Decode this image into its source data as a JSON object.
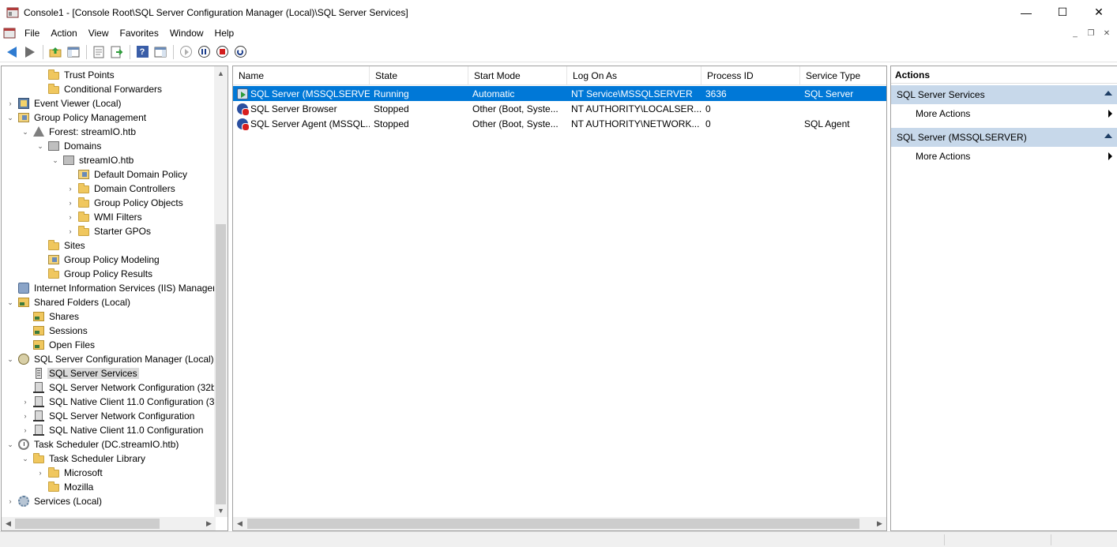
{
  "window": {
    "title": "Console1 - [Console Root\\SQL Server Configuration Manager (Local)\\SQL Server Services]",
    "controls": {
      "minimize": "—",
      "maximize": "☐",
      "close": "✕"
    }
  },
  "menu": {
    "items": [
      "File",
      "Action",
      "View",
      "Favorites",
      "Window",
      "Help"
    ],
    "mdi": {
      "minimize": "_",
      "restore": "❐",
      "close": "✕"
    }
  },
  "toolbar": {
    "buttons": [
      "back-icon",
      "forward-icon",
      "up-one-level-icon",
      "show-hide-console-tree-icon",
      "properties-icon",
      "export-list-icon",
      "help-icon",
      "show-hide-action-pane-icon",
      "start-service-icon",
      "pause-service-icon",
      "stop-service-icon",
      "restart-service-icon"
    ]
  },
  "tree": {
    "items": [
      {
        "label": "Trust Points",
        "indent": 3,
        "expander": "",
        "icon": "folder"
      },
      {
        "label": "Conditional Forwarders",
        "indent": 3,
        "expander": "",
        "icon": "folder"
      },
      {
        "label": "Event Viewer (Local)",
        "indent": 1,
        "expander": "›",
        "icon": "viewer"
      },
      {
        "label": "Group Policy Management",
        "indent": 1,
        "expander": "⌄",
        "icon": "gpo"
      },
      {
        "label": "Forest: streamIO.htb",
        "indent": 2,
        "expander": "⌄",
        "icon": "forest"
      },
      {
        "label": "Domains",
        "indent": 3,
        "expander": "⌄",
        "icon": "domain"
      },
      {
        "label": "streamIO.htb",
        "indent": 4,
        "expander": "⌄",
        "icon": "domain"
      },
      {
        "label": "Default Domain Policy",
        "indent": 5,
        "expander": "",
        "icon": "gpo"
      },
      {
        "label": "Domain Controllers",
        "indent": 5,
        "expander": "›",
        "icon": "folder"
      },
      {
        "label": "Group Policy Objects",
        "indent": 5,
        "expander": "›",
        "icon": "folder"
      },
      {
        "label": "WMI Filters",
        "indent": 5,
        "expander": "›",
        "icon": "folder"
      },
      {
        "label": "Starter GPOs",
        "indent": 5,
        "expander": "›",
        "icon": "folder"
      },
      {
        "label": "Sites",
        "indent": 3,
        "expander": "",
        "icon": "folder"
      },
      {
        "label": "Group Policy Modeling",
        "indent": 3,
        "expander": "",
        "icon": "gpo"
      },
      {
        "label": "Group Policy Results",
        "indent": 3,
        "expander": "",
        "icon": "folder"
      },
      {
        "label": "Internet Information Services (IIS) Manager",
        "indent": 1,
        "expander": "",
        "icon": "iis"
      },
      {
        "label": "Shared Folders (Local)",
        "indent": 1,
        "expander": "⌄",
        "icon": "share"
      },
      {
        "label": "Shares",
        "indent": 2,
        "expander": "",
        "icon": "share"
      },
      {
        "label": "Sessions",
        "indent": 2,
        "expander": "",
        "icon": "share"
      },
      {
        "label": "Open Files",
        "indent": 2,
        "expander": "",
        "icon": "share"
      },
      {
        "label": "SQL Server Configuration Manager (Local)",
        "indent": 1,
        "expander": "⌄",
        "icon": "sqlcm"
      },
      {
        "label": "SQL Server Services",
        "indent": 2,
        "expander": "",
        "icon": "server",
        "selected": true
      },
      {
        "label": "SQL Server Network Configuration (32b",
        "indent": 2,
        "expander": "",
        "icon": "netcfg"
      },
      {
        "label": "SQL Native Client 11.0 Configuration (3.",
        "indent": 2,
        "expander": "›",
        "icon": "netcfg"
      },
      {
        "label": "SQL Server Network Configuration",
        "indent": 2,
        "expander": "›",
        "icon": "netcfg"
      },
      {
        "label": "SQL Native Client 11.0 Configuration",
        "indent": 2,
        "expander": "›",
        "icon": "netcfg"
      },
      {
        "label": "Task Scheduler (DC.streamIO.htb)",
        "indent": 1,
        "expander": "⌄",
        "icon": "clock"
      },
      {
        "label": "Task Scheduler Library",
        "indent": 2,
        "expander": "⌄",
        "icon": "folder"
      },
      {
        "label": "Microsoft",
        "indent": 3,
        "expander": "›",
        "icon": "folder"
      },
      {
        "label": "Mozilla",
        "indent": 3,
        "expander": "",
        "icon": "folder"
      },
      {
        "label": "Services (Local)",
        "indent": 1,
        "expander": "›",
        "icon": "gear"
      }
    ]
  },
  "list": {
    "columns": [
      "Name",
      "State",
      "Start Mode",
      "Log On As",
      "Process ID",
      "Service Type"
    ],
    "rows": [
      {
        "name": "SQL Server (MSSQLSERVER)",
        "state": "Running",
        "start_mode": "Automatic",
        "log_on_as": "NT Service\\MSSQLSERVER",
        "process_id": "3636",
        "service_type": "SQL Server",
        "icon": "svc-run",
        "selected": true
      },
      {
        "name": "SQL Server Browser",
        "state": "Stopped",
        "start_mode": "Other (Boot, Syste...",
        "log_on_as": "NT AUTHORITY\\LOCALSER...",
        "process_id": "0",
        "service_type": "",
        "icon": "svc-stop"
      },
      {
        "name": "SQL Server Agent (MSSQL...",
        "state": "Stopped",
        "start_mode": "Other (Boot, Syste...",
        "log_on_as": "NT AUTHORITY\\NETWORK...",
        "process_id": "0",
        "service_type": "SQL Agent",
        "icon": "svc-stop"
      }
    ]
  },
  "actions": {
    "title": "Actions",
    "sections": [
      {
        "header": "SQL Server Services",
        "items": [
          "More Actions"
        ]
      },
      {
        "header": "SQL Server (MSSQLSERVER)",
        "items": [
          "More Actions"
        ]
      }
    ]
  },
  "colors": {
    "selection": "#0078d7",
    "action_section_bg": "#c7d8ea",
    "tree_selection": "#d9d9d9"
  }
}
